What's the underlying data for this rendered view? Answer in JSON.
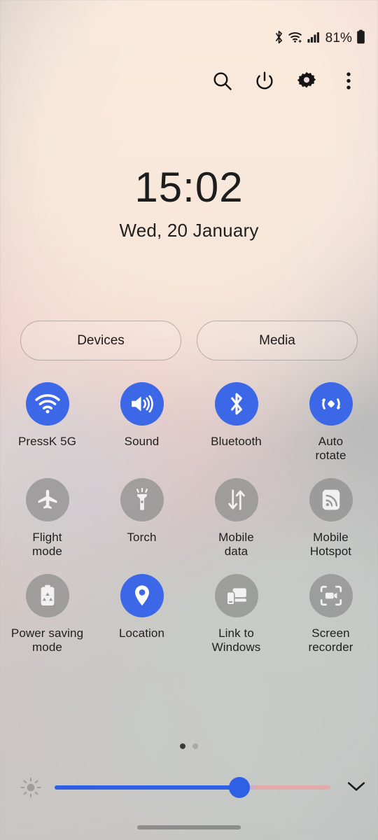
{
  "status_bar": {
    "icons": [
      "bluetooth-icon",
      "wifi-icon",
      "signal-icon"
    ],
    "battery_percent": "81%",
    "battery_icon": "battery-full-icon"
  },
  "header": {
    "buttons": [
      {
        "name": "search-button",
        "icon": "search-icon"
      },
      {
        "name": "power-button",
        "icon": "power-icon"
      },
      {
        "name": "settings-button",
        "icon": "gear-icon"
      },
      {
        "name": "more-button",
        "icon": "overflow-menu-icon"
      }
    ]
  },
  "clock": {
    "time": "15:02",
    "date": "Wed, 20 January"
  },
  "pills": [
    {
      "label": "Devices",
      "name": "devices-pill"
    },
    {
      "label": "Media",
      "name": "media-pill"
    }
  ],
  "tiles": [
    {
      "label": "PressK 5G",
      "icon": "wifi-icon",
      "active": true
    },
    {
      "label": "Sound",
      "icon": "volume-icon",
      "active": true
    },
    {
      "label": "Bluetooth",
      "icon": "bluetooth-icon",
      "active": true
    },
    {
      "label": "Auto\nrotate",
      "icon": "auto-rotate-icon",
      "active": true
    },
    {
      "label": "Flight\nmode",
      "icon": "airplane-icon",
      "active": false
    },
    {
      "label": "Torch",
      "icon": "flashlight-icon",
      "active": false
    },
    {
      "label": "Mobile\ndata",
      "icon": "data-transfer-icon",
      "active": false
    },
    {
      "label": "Mobile\nHotspot",
      "icon": "hotspot-icon",
      "active": false
    },
    {
      "label": "Power saving\nmode",
      "icon": "battery-saver-icon",
      "active": false
    },
    {
      "label": "Location",
      "icon": "location-pin-icon",
      "active": true
    },
    {
      "label": "Link to\nWindows",
      "icon": "link-windows-icon",
      "active": false
    },
    {
      "label": "Screen\nrecorder",
      "icon": "screen-recorder-icon",
      "active": false
    }
  ],
  "page_indicator": {
    "total": 2,
    "current": 1
  },
  "brightness": {
    "icon": "brightness-sun-icon",
    "value_percent": 67,
    "expand_icon": "chevron-down-icon"
  },
  "navigation": {
    "home_bar": "gesture-home-bar"
  },
  "colors": {
    "accent_blue": "#3c68e8",
    "slider_blue": "#2f5fe4",
    "tile_off": "#8c8c8c",
    "text": "#1f1f1f"
  }
}
